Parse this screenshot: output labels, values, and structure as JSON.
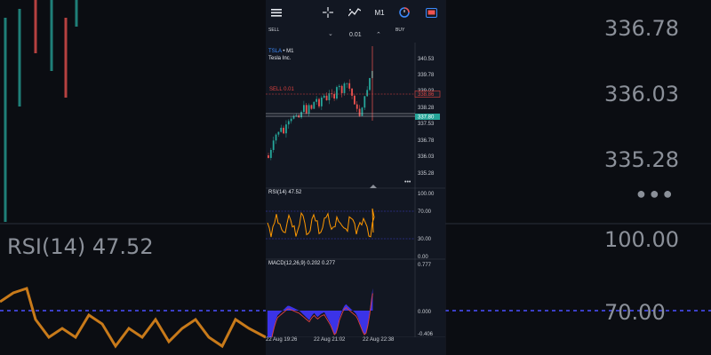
{
  "background": {
    "price_labels": [
      "336.78",
      "336.03",
      "335.28"
    ],
    "rsi_label": "RSI(14) 47.52",
    "level_labels": [
      "100.00",
      "70.00"
    ],
    "more_icon": "more-dots-icon"
  },
  "toolbar": {
    "menu_icon": "menu-icon",
    "crosshair_icon": "crosshair-icon",
    "indicators_icon": "indicators-icon",
    "timeframe": "M1",
    "clock_icon": "clock-icon",
    "objects_icon": "objects-icon"
  },
  "trade": {
    "sell_label": "SELL",
    "buy_label": "BUY",
    "lot": "0.01",
    "down_icon": "chevron-down-icon",
    "up_icon": "chevron-up-icon"
  },
  "symbol": {
    "ticker": "TSLA",
    "timeframe_suffix": " • M1",
    "name": "Tesla Inc."
  },
  "price_chart": {
    "axis_labels": [
      "340.53",
      "339.78",
      "339.03",
      "338.28",
      "337.53",
      "336.78",
      "336.03",
      "335.28"
    ],
    "sell_line_label": "SELL 0.01",
    "sell_price_tag": "338.86",
    "bid_tag": "337.80",
    "colors": {
      "up": "#26a69a",
      "down": "#ef5350",
      "sell": "#e0413f",
      "bid": "#26a69a"
    }
  },
  "rsi": {
    "label": "RSI(14) 47.52",
    "axis_labels": [
      "100.00",
      "70.00",
      "30.00",
      "0.00"
    ],
    "color": "#ff9800"
  },
  "macd": {
    "label": "MACD(12,26,9) 0.202 0.277",
    "axis_labels": [
      "0.777",
      "0.000",
      "-0.406"
    ],
    "hist_color": "#3b33e8",
    "signal_color": "#e0413f"
  },
  "time_labels": [
    "22 Aug 19:26",
    "22 Aug 21:02",
    "22 Aug 22:38"
  ]
}
